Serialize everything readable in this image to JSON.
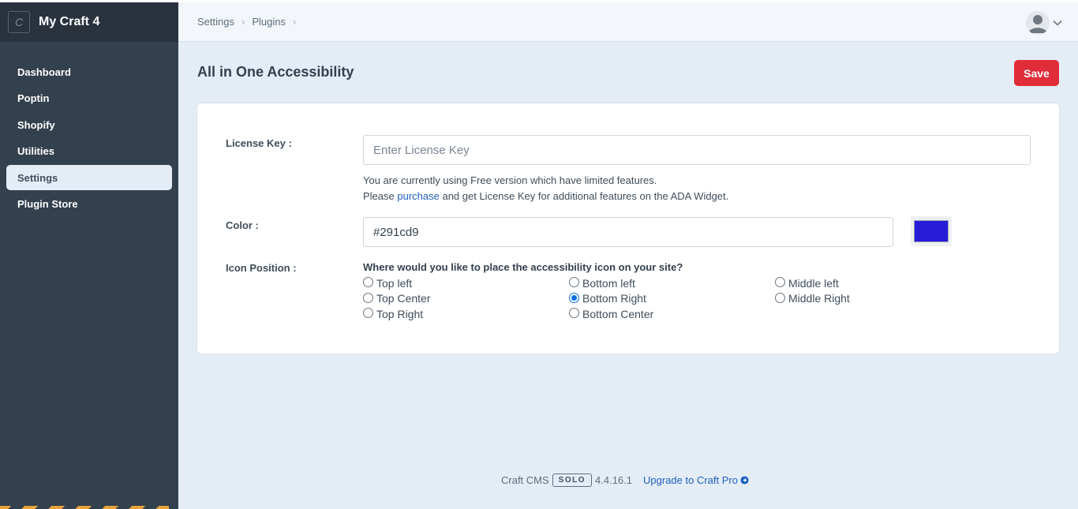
{
  "site": {
    "icon_letter": "C",
    "name": "My Craft 4"
  },
  "sidebar": {
    "items": [
      {
        "label": "Dashboard",
        "active": false
      },
      {
        "label": "Poptin",
        "active": false
      },
      {
        "label": "Shopify",
        "active": false
      },
      {
        "label": "Utilities",
        "active": false
      },
      {
        "label": "Settings",
        "active": true
      },
      {
        "label": "Plugin Store",
        "active": false
      }
    ]
  },
  "breadcrumb": {
    "items": [
      "Settings",
      "Plugins"
    ]
  },
  "user_menu": {
    "avatar_icon": "user-silhouette-icon",
    "chevron_icon": "chevron-down-icon"
  },
  "page": {
    "title": "All in One Accessibility",
    "save_label": "Save"
  },
  "form": {
    "license": {
      "label": "License Key :",
      "value": "",
      "placeholder": "Enter License Key",
      "hint_line1": "You are currently using Free version which have limited features.",
      "hint_line2_prefix": "Please ",
      "hint_link": "purchase",
      "hint_line2_suffix": " and get License Key for additional features on the ADA Widget."
    },
    "color": {
      "label": "Color :",
      "value": "#291cd9",
      "swatch": "#291cd9"
    },
    "icon_position": {
      "label": "Icon Position :",
      "question": "Where would you like to place the accessibility icon on your site?",
      "columns": [
        [
          {
            "label": "Top left",
            "checked": false
          },
          {
            "label": "Top Center",
            "checked": false
          },
          {
            "label": "Top Right",
            "checked": false
          }
        ],
        [
          {
            "label": "Bottom left",
            "checked": false
          },
          {
            "label": "Bottom Right",
            "checked": true
          },
          {
            "label": "Bottom Center",
            "checked": false
          }
        ],
        [
          {
            "label": "Middle left",
            "checked": false
          },
          {
            "label": "Middle Right",
            "checked": false
          }
        ]
      ]
    }
  },
  "footer": {
    "product": "Craft CMS",
    "edition": "SOLO",
    "version": "4.4.16.1",
    "upgrade_label": "Upgrade to Craft Pro",
    "upgrade_icon": "arrow-circle-right-icon"
  },
  "colors": {
    "accent": "#e12d39",
    "sidebar_bg": "#33404d",
    "link": "#1f5fbf",
    "page_bg": "#e4edf6"
  }
}
